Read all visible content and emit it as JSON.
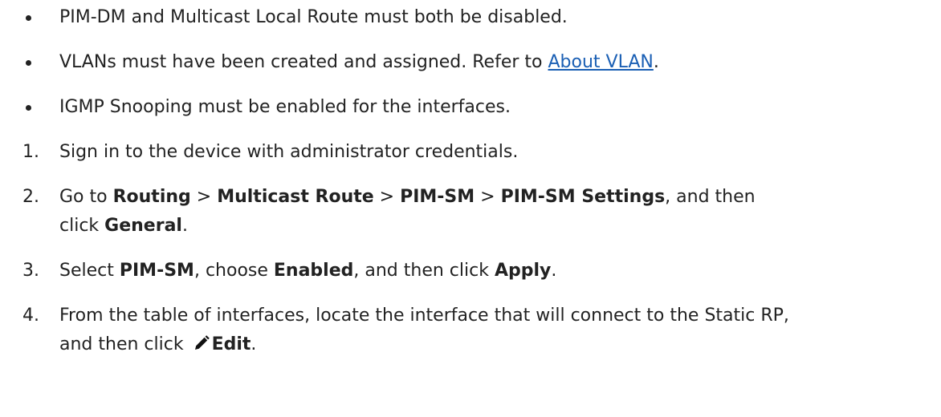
{
  "bullets": [
    {
      "text": "PIM-DM and Multicast Local Route must both be disabled."
    },
    {
      "before": "VLANs must have been created and assigned. Refer to ",
      "link": "About VLAN",
      "after": "."
    },
    {
      "text": "IGMP Snooping must be enabled for the interfaces."
    }
  ],
  "steps": {
    "s1": {
      "num": "1.",
      "text": "Sign in to the device with administrator credentials."
    },
    "s2": {
      "num": "2.",
      "t1": "Go to ",
      "b1": "Routing",
      "sep1": " > ",
      "b2": "Multicast Route",
      "sep2": " > ",
      "b3": "PIM-SM",
      "sep3": " > ",
      "b4": "PIM-SM Settings",
      "t2": ", and then",
      "t3": "click ",
      "b5": "General",
      "t4": "."
    },
    "s3": {
      "num": "3.",
      "t1": "Select ",
      "b1": "PIM-SM",
      "t2": ", choose ",
      "b2": "Enabled",
      "t3": ", and then click ",
      "b3": "Apply",
      "t4": "."
    },
    "s4": {
      "num": "4.",
      "t1": "From the table of interfaces, locate the interface that will connect to the Static RP,",
      "t2": "and then click ",
      "icon": "pencil-icon",
      "b1": "Edit",
      "t3": "."
    }
  }
}
